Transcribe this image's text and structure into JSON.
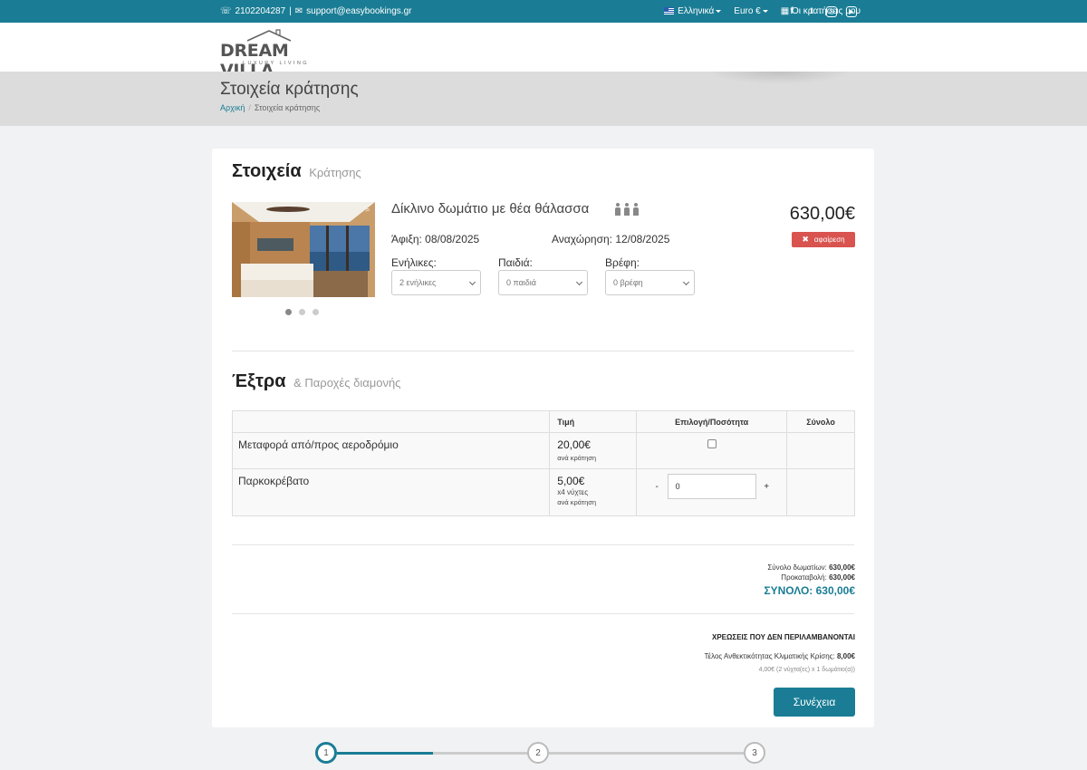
{
  "topbar": {
    "phone": "2102204287",
    "separator": "|",
    "email": "support@easybookings.gr",
    "language": "Ελληνικά",
    "currency": "Euro €",
    "my_bookings": "Οι κρατήσεις μου",
    "social": [
      "facebook-icon",
      "twitter-icon",
      "instagram-icon",
      "youtube-icon"
    ]
  },
  "logo": {
    "name": "DREAM VILLA",
    "tagline": "LUXURY LIVING"
  },
  "page": {
    "title": "Στοιχεία κράτησης",
    "breadcrumb": {
      "home": "Αρχική",
      "current": "Στοιχεία κράτησης"
    }
  },
  "booking": {
    "title": "Στοιχεία",
    "subtitle": "Κράτησης",
    "room_name": "Δίκλινο δωμάτιο με θέα θάλασσα",
    "price": "630,00€",
    "remove_label": "αφαίρεση",
    "arrival": "Άφιξη: 08/08/2025",
    "departure": "Αναχώρηση: 12/08/2025",
    "adults_label": "Ενήλικες:",
    "children_label": "Παιδιά:",
    "infants_label": "Βρέφη:",
    "adults_value": "2 ενήλικες",
    "children_value": "0 παιδιά",
    "infants_value": "0 βρέφη",
    "carousel_index": 1,
    "carousel_count": 3
  },
  "extras": {
    "title": "Έξτρα",
    "subtitle": "& Παροχές διαμονής",
    "headers": [
      "",
      "Τιμή",
      "Επιλογή/Ποσότητα",
      "Σύνολο"
    ],
    "rows": [
      {
        "name": "Μεταφορά από/προς αεροδρόμιο",
        "price": "20,00€",
        "note1": "ανά κράτηση",
        "note2": ""
      },
      {
        "name": "Παρκοκρέβατο",
        "price": "5,00€",
        "note1": "x4 νύχτες",
        "note2": "ανά κράτηση",
        "qty": "0",
        "minus": "-",
        "plus": "+"
      }
    ]
  },
  "totals": {
    "rooms": "Σύνολο δωματίων:",
    "rooms_value": "630,00€",
    "deposit": "Προκαταβολή:",
    "deposit_value": "630,00€",
    "grand": "ΣΥΝΟΛΟ: 630,00€",
    "not_included": "ΧΡΕΩΣΕΙΣ ΠΟΥ ΔΕΝ ΠΕΡΙΛΑΜΒΑΝΟΝΤΑΙ",
    "tax_label": "Τέλος Ανθεκτικότητας Κλιματικής Κρίσης:",
    "tax_value": "8,00€",
    "tax_detail": "4,00€ (2 νύχτα(ες) x 1 δωμάτιο(α))",
    "continue": "Συνέχεια"
  },
  "steps": [
    "1",
    "2",
    "3"
  ],
  "colors": {
    "accent": "#1a7d95",
    "danger": "#d9534f"
  }
}
